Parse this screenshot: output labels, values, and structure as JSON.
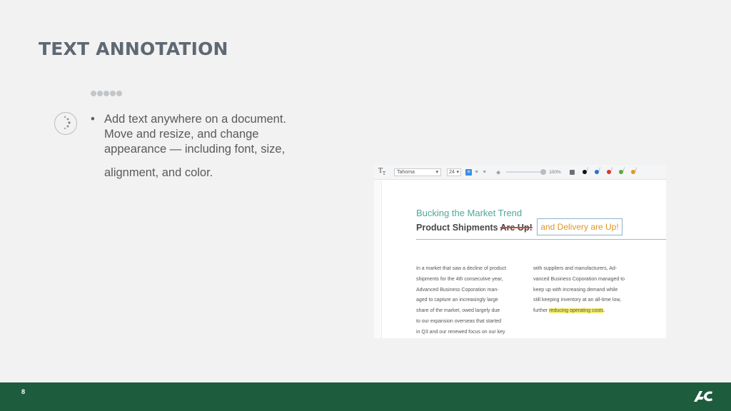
{
  "slide": {
    "title": "TEXT ANNOTATION",
    "bullet_lines": [
      "Add text anywhere on a document.",
      "Move and resize, and change",
      "appearance — including font, size,"
    ],
    "bullet_continuation": "alignment, and color."
  },
  "screenshot": {
    "toolbar": {
      "tool_icon": "text-tool-icon",
      "font_name": "Tahoma",
      "font_size": "24",
      "opacity": "100%",
      "swatch_colors": [
        "#111111",
        "#2b6fd6",
        "#d8392f",
        "#5aa83a",
        "#e2962a"
      ]
    },
    "document": {
      "heading": "Bucking the Market Trend",
      "subheading_text": "Product Shipments",
      "struck_text": "Are Up!",
      "added_annotation": "and Delivery are Up!",
      "column1_lines": [
        "In a market that saw a decline of product",
        "shipments for the 4th consecutive year,",
        "Advanced Business Coporation man-",
        "aged to capture an increasingly large",
        "share of the market, owed largely due",
        "to our expansion overseas that started",
        "in Q3 and our renewed focus on our key"
      ],
      "column2_lines": [
        "with suppliers and manufacturers, Ad-",
        "vanced Business Coporation managed to",
        "keep up with increasing demand while",
        "still keeping inventory at an all-time low,"
      ],
      "column2_last_prefix": "further ",
      "highlighted_text": "reducing operating costs",
      "column2_last_suffix": "."
    }
  },
  "footer": {
    "page_number": "8",
    "background_color": "#1e5c3e"
  }
}
